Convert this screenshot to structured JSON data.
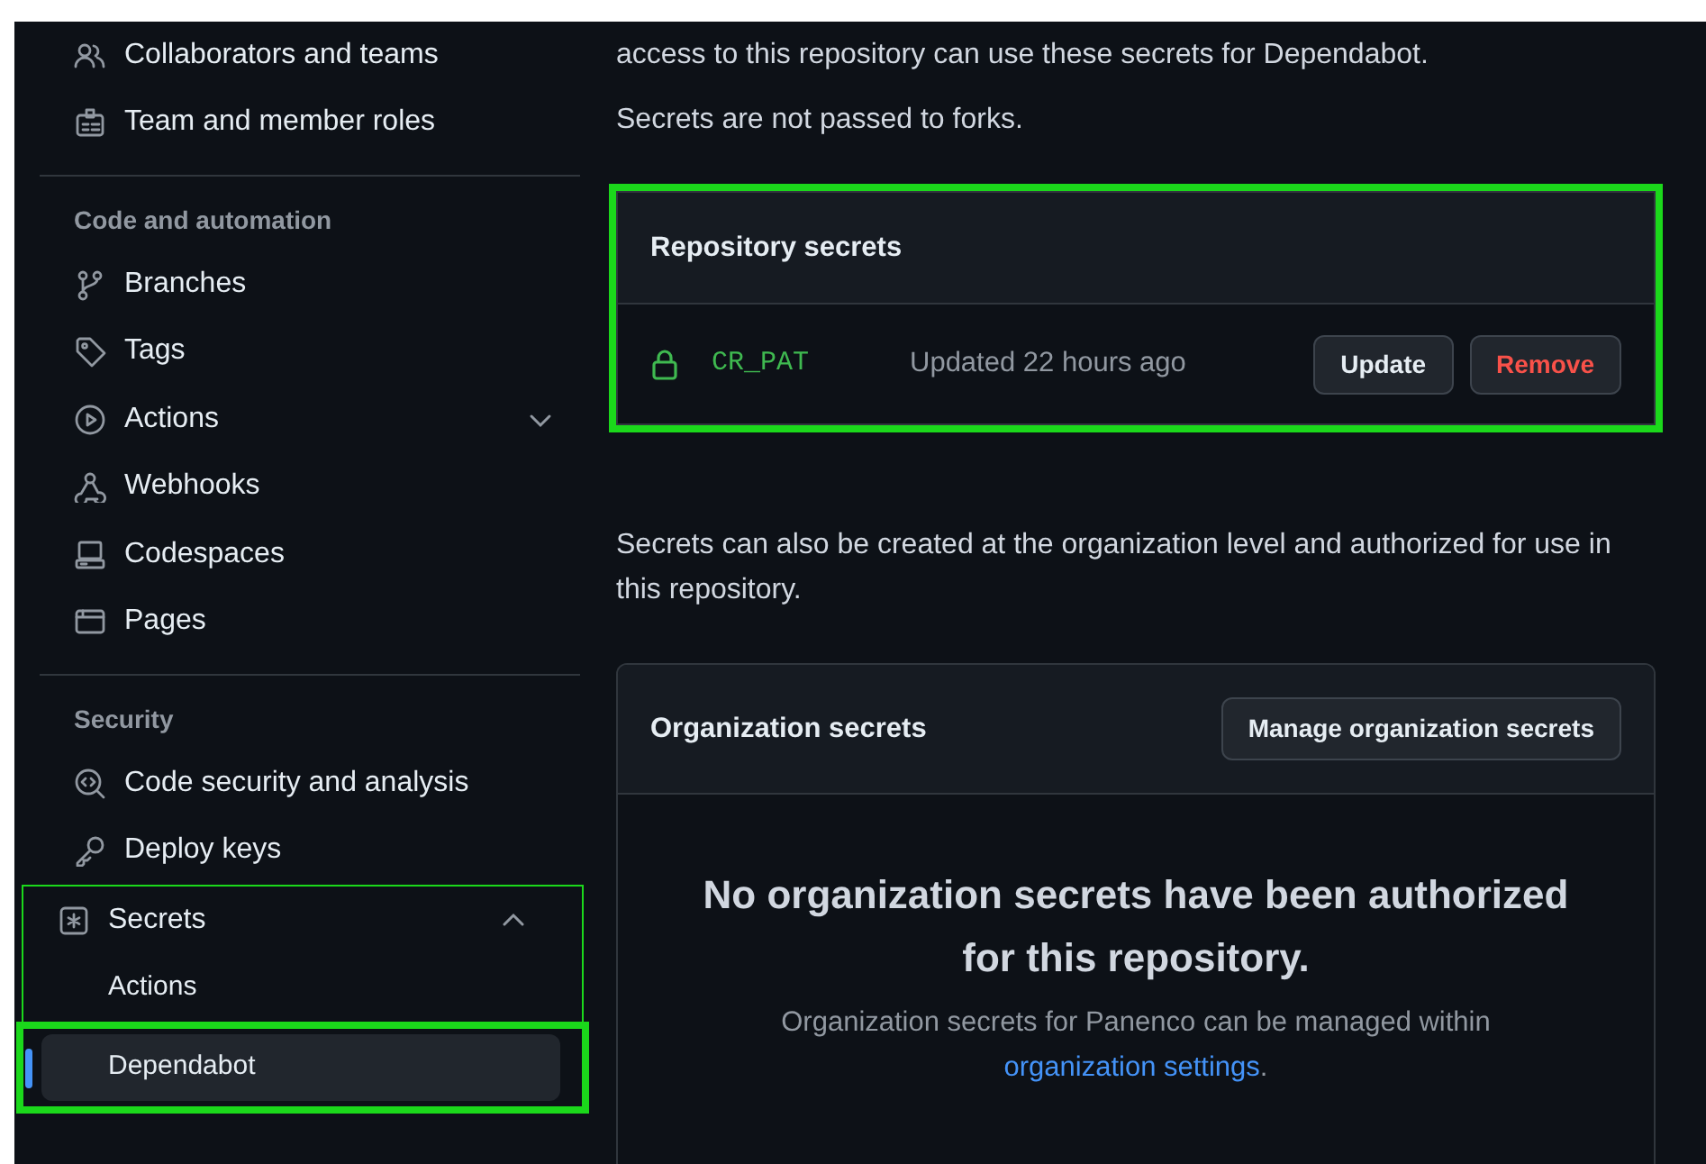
{
  "sidebar": {
    "groups": [
      {
        "items": [
          {
            "label": "Collaborators and teams"
          },
          {
            "label": "Team and member roles"
          }
        ]
      },
      {
        "heading": "Code and automation",
        "items": [
          {
            "label": "Branches"
          },
          {
            "label": "Tags"
          },
          {
            "label": "Actions",
            "expanded": false
          },
          {
            "label": "Webhooks"
          },
          {
            "label": "Codespaces"
          },
          {
            "label": "Pages"
          }
        ]
      },
      {
        "heading": "Security",
        "items": [
          {
            "label": "Code security and analysis"
          },
          {
            "label": "Deploy keys"
          },
          {
            "label": "Secrets",
            "expanded": true,
            "highlighted": true,
            "bold_frame": false,
            "children": [
              {
                "label": "Actions",
                "selected": false
              },
              {
                "label": "Dependabot",
                "selected": true,
                "highlighted": true,
                "bold_frame": true
              }
            ]
          }
        ]
      }
    ]
  },
  "intro": [
    "access to this repository can use these secrets for Dependabot.",
    "Secrets are not passed to forks."
  ],
  "repository_secrets": {
    "title": "Repository secrets",
    "highlighted": true,
    "bold_frame": true,
    "secrets": [
      {
        "name": "CR_PAT",
        "updated": "Updated 22 hours ago",
        "buttons": [
          {
            "label": "Update",
            "kind": "default"
          },
          {
            "label": "Remove",
            "kind": "danger"
          }
        ]
      }
    ]
  },
  "org_note": "Secrets can also be created at the organization level and authorized for use in this repository.",
  "organization_secrets": {
    "title": "Organization secrets",
    "button": "Manage organization secrets",
    "empty_title": "No organization secrets have been authorized for this repository.",
    "empty_text": "Organization secrets for Panenco can be managed within",
    "link": "organization settings",
    "link_after": "."
  }
}
